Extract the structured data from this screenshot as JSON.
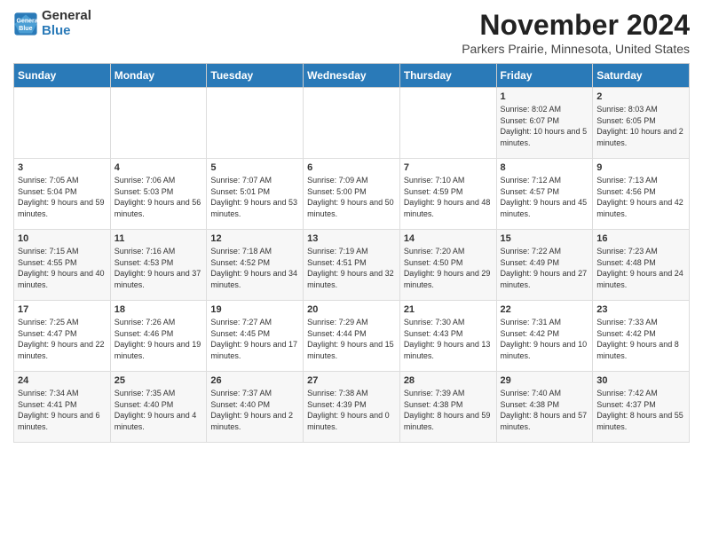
{
  "logo": {
    "line1": "General",
    "line2": "Blue"
  },
  "title": "November 2024",
  "subtitle": "Parkers Prairie, Minnesota, United States",
  "days_of_week": [
    "Sunday",
    "Monday",
    "Tuesday",
    "Wednesday",
    "Thursday",
    "Friday",
    "Saturday"
  ],
  "weeks": [
    [
      {
        "day": "",
        "info": ""
      },
      {
        "day": "",
        "info": ""
      },
      {
        "day": "",
        "info": ""
      },
      {
        "day": "",
        "info": ""
      },
      {
        "day": "",
        "info": ""
      },
      {
        "day": "1",
        "info": "Sunrise: 8:02 AM\nSunset: 6:07 PM\nDaylight: 10 hours and 5 minutes."
      },
      {
        "day": "2",
        "info": "Sunrise: 8:03 AM\nSunset: 6:05 PM\nDaylight: 10 hours and 2 minutes."
      }
    ],
    [
      {
        "day": "3",
        "info": "Sunrise: 7:05 AM\nSunset: 5:04 PM\nDaylight: 9 hours and 59 minutes."
      },
      {
        "day": "4",
        "info": "Sunrise: 7:06 AM\nSunset: 5:03 PM\nDaylight: 9 hours and 56 minutes."
      },
      {
        "day": "5",
        "info": "Sunrise: 7:07 AM\nSunset: 5:01 PM\nDaylight: 9 hours and 53 minutes."
      },
      {
        "day": "6",
        "info": "Sunrise: 7:09 AM\nSunset: 5:00 PM\nDaylight: 9 hours and 50 minutes."
      },
      {
        "day": "7",
        "info": "Sunrise: 7:10 AM\nSunset: 4:59 PM\nDaylight: 9 hours and 48 minutes."
      },
      {
        "day": "8",
        "info": "Sunrise: 7:12 AM\nSunset: 4:57 PM\nDaylight: 9 hours and 45 minutes."
      },
      {
        "day": "9",
        "info": "Sunrise: 7:13 AM\nSunset: 4:56 PM\nDaylight: 9 hours and 42 minutes."
      }
    ],
    [
      {
        "day": "10",
        "info": "Sunrise: 7:15 AM\nSunset: 4:55 PM\nDaylight: 9 hours and 40 minutes."
      },
      {
        "day": "11",
        "info": "Sunrise: 7:16 AM\nSunset: 4:53 PM\nDaylight: 9 hours and 37 minutes."
      },
      {
        "day": "12",
        "info": "Sunrise: 7:18 AM\nSunset: 4:52 PM\nDaylight: 9 hours and 34 minutes."
      },
      {
        "day": "13",
        "info": "Sunrise: 7:19 AM\nSunset: 4:51 PM\nDaylight: 9 hours and 32 minutes."
      },
      {
        "day": "14",
        "info": "Sunrise: 7:20 AM\nSunset: 4:50 PM\nDaylight: 9 hours and 29 minutes."
      },
      {
        "day": "15",
        "info": "Sunrise: 7:22 AM\nSunset: 4:49 PM\nDaylight: 9 hours and 27 minutes."
      },
      {
        "day": "16",
        "info": "Sunrise: 7:23 AM\nSunset: 4:48 PM\nDaylight: 9 hours and 24 minutes."
      }
    ],
    [
      {
        "day": "17",
        "info": "Sunrise: 7:25 AM\nSunset: 4:47 PM\nDaylight: 9 hours and 22 minutes."
      },
      {
        "day": "18",
        "info": "Sunrise: 7:26 AM\nSunset: 4:46 PM\nDaylight: 9 hours and 19 minutes."
      },
      {
        "day": "19",
        "info": "Sunrise: 7:27 AM\nSunset: 4:45 PM\nDaylight: 9 hours and 17 minutes."
      },
      {
        "day": "20",
        "info": "Sunrise: 7:29 AM\nSunset: 4:44 PM\nDaylight: 9 hours and 15 minutes."
      },
      {
        "day": "21",
        "info": "Sunrise: 7:30 AM\nSunset: 4:43 PM\nDaylight: 9 hours and 13 minutes."
      },
      {
        "day": "22",
        "info": "Sunrise: 7:31 AM\nSunset: 4:42 PM\nDaylight: 9 hours and 10 minutes."
      },
      {
        "day": "23",
        "info": "Sunrise: 7:33 AM\nSunset: 4:42 PM\nDaylight: 9 hours and 8 minutes."
      }
    ],
    [
      {
        "day": "24",
        "info": "Sunrise: 7:34 AM\nSunset: 4:41 PM\nDaylight: 9 hours and 6 minutes."
      },
      {
        "day": "25",
        "info": "Sunrise: 7:35 AM\nSunset: 4:40 PM\nDaylight: 9 hours and 4 minutes."
      },
      {
        "day": "26",
        "info": "Sunrise: 7:37 AM\nSunset: 4:40 PM\nDaylight: 9 hours and 2 minutes."
      },
      {
        "day": "27",
        "info": "Sunrise: 7:38 AM\nSunset: 4:39 PM\nDaylight: 9 hours and 0 minutes."
      },
      {
        "day": "28",
        "info": "Sunrise: 7:39 AM\nSunset: 4:38 PM\nDaylight: 8 hours and 59 minutes."
      },
      {
        "day": "29",
        "info": "Sunrise: 7:40 AM\nSunset: 4:38 PM\nDaylight: 8 hours and 57 minutes."
      },
      {
        "day": "30",
        "info": "Sunrise: 7:42 AM\nSunset: 4:37 PM\nDaylight: 8 hours and 55 minutes."
      }
    ]
  ]
}
